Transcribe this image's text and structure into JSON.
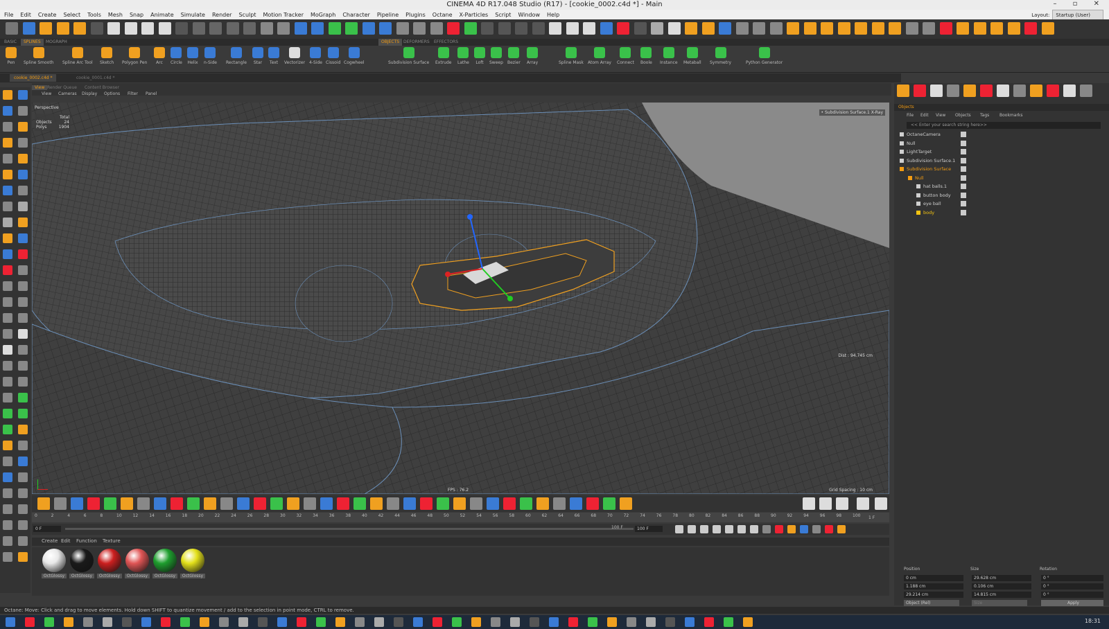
{
  "window": {
    "title": "CINEMA 4D R17.048 Studio (R17) - [cookie_0002.c4d *] - Main"
  },
  "menu": [
    "File",
    "Edit",
    "Create",
    "Select",
    "Tools",
    "Mesh",
    "Snap",
    "Animate",
    "Simulate",
    "Render",
    "Sculpt",
    "Motion Tracker",
    "MoGraph",
    "Character",
    "Pipeline",
    "Plugins",
    "Octane",
    "X-Particles",
    "Script",
    "Window",
    "Help"
  ],
  "layout": {
    "label": "Layout:",
    "value": "Startup (User)"
  },
  "palette_tabs": [
    "BASIC",
    "SPLINES",
    "MOGRAPH",
    "OBJECTS",
    "DEFORMERS",
    "EFFECTORS"
  ],
  "palette_items": [
    "Pen",
    "Spline Smooth",
    "Spline Arc Tool",
    "Sketch",
    "Polygon Pen",
    "Arc",
    "Circle",
    "Helix",
    "n-Side",
    "Rectangle",
    "Star",
    "Text",
    "Vectorizer",
    "4-Side",
    "Cissoid",
    "Cogwheel",
    "Subdivision Surface",
    "Extrude",
    "Lathe",
    "Loft",
    "Sweep",
    "Bezier",
    "Array",
    "Spline Mask",
    "Atom Array",
    "Connect",
    "Boole",
    "Instance",
    "Metaball",
    "Symmetry",
    "Python Generator"
  ],
  "doc_tabs": [
    "cookie_0002.c4d *",
    "cookie_0001.c4d *"
  ],
  "viewport": {
    "tabs": [
      "View",
      "Render Queue",
      "Content Browser"
    ],
    "menu": [
      "View",
      "Cameras",
      "Display",
      "Options",
      "Filter",
      "Panel"
    ],
    "mode": "Perspective",
    "stats_total": "Total",
    "stats_objects_label": "Objects",
    "stats_objects": "24",
    "stats_polys_label": "Polys",
    "stats_polys": "1904",
    "camera_badge": "• Subdivision Surface.1 X-Ray",
    "dist": "Dist : 94.745 cm",
    "fps": "FPS : 76.2",
    "grid": "Grid Spacing : 10 cm"
  },
  "timeline": {
    "ticks": [
      "0",
      "2",
      "4",
      "6",
      "8",
      "10",
      "12",
      "14",
      "16",
      "18",
      "20",
      "22",
      "24",
      "26",
      "28",
      "30",
      "32",
      "34",
      "36",
      "38",
      "40",
      "42",
      "44",
      "46",
      "48",
      "50",
      "52",
      "54",
      "56",
      "58",
      "60",
      "62",
      "64",
      "66",
      "68",
      "70",
      "72",
      "74",
      "76",
      "78",
      "80",
      "82",
      "84",
      "86",
      "88",
      "90",
      "92",
      "94",
      "96",
      "98",
      "100"
    ],
    "frame_end_marker": "1 F",
    "start": "0 F",
    "end": "100 F",
    "end2": "100 F"
  },
  "materials": {
    "menu": [
      "Create",
      "Edit",
      "Function",
      "Texture"
    ],
    "items": [
      {
        "label": "OctGlossy",
        "color": "#e8e8e8"
      },
      {
        "label": "OctGlossy",
        "color": "#1a1a1a"
      },
      {
        "label": "OctGlossy",
        "color": "#cc1f1f"
      },
      {
        "label": "OctGlossy",
        "color": "#e05555"
      },
      {
        "label": "OctGlossy",
        "color": "#1e9e2e"
      },
      {
        "label": "OctGlossy",
        "color": "#e3e01a"
      }
    ]
  },
  "objects_panel": {
    "title": "Objects",
    "menu": [
      "File",
      "Edit",
      "View",
      "Objects",
      "Tags",
      "Bookmarks"
    ],
    "search_placeholder": "<< Enter your search string here>>",
    "rows": [
      {
        "name": "OctaneCamera",
        "indent": 0,
        "color": "#cfcfcf"
      },
      {
        "name": "Null",
        "indent": 0,
        "color": "#cfcfcf"
      },
      {
        "name": "LightTarget",
        "indent": 0,
        "color": "#cfcfcf"
      },
      {
        "name": "Subdivision Surface.1",
        "indent": 0,
        "color": "#cfcfcf"
      },
      {
        "name": "Subdivision Surface",
        "indent": 0,
        "color": "#f39c12"
      },
      {
        "name": "Null",
        "indent": 1,
        "color": "#f39c12"
      },
      {
        "name": "hat balls.1",
        "indent": 2,
        "color": "#cfcfcf"
      },
      {
        "name": "button body",
        "indent": 2,
        "color": "#cfcfcf"
      },
      {
        "name": "eye ball",
        "indent": 2,
        "color": "#cfcfcf"
      },
      {
        "name": "body",
        "indent": 2,
        "color": "#f3c312"
      }
    ]
  },
  "attributes": {
    "headers": [
      "Position",
      "Size",
      "Rotation"
    ],
    "x": {
      "pos": "0 cm",
      "size": "29.628 cm",
      "rot": "0 °"
    },
    "y": {
      "pos": "1.188 cm",
      "size": "0.106 cm",
      "rot": "0 °"
    },
    "z": {
      "pos": "29.214 cm",
      "size": "14.815 cm",
      "rot": "0 °"
    },
    "mode": "Object (Rel)",
    "size_mode": "Size",
    "apply": "Apply"
  },
  "status": {
    "text": "Octane:     Move: Click and drag to move elements. Hold down SHIFT to quantize movement / add to the selection in point mode, CTRL to remove."
  },
  "taskbar": {
    "clock": "18:31"
  }
}
